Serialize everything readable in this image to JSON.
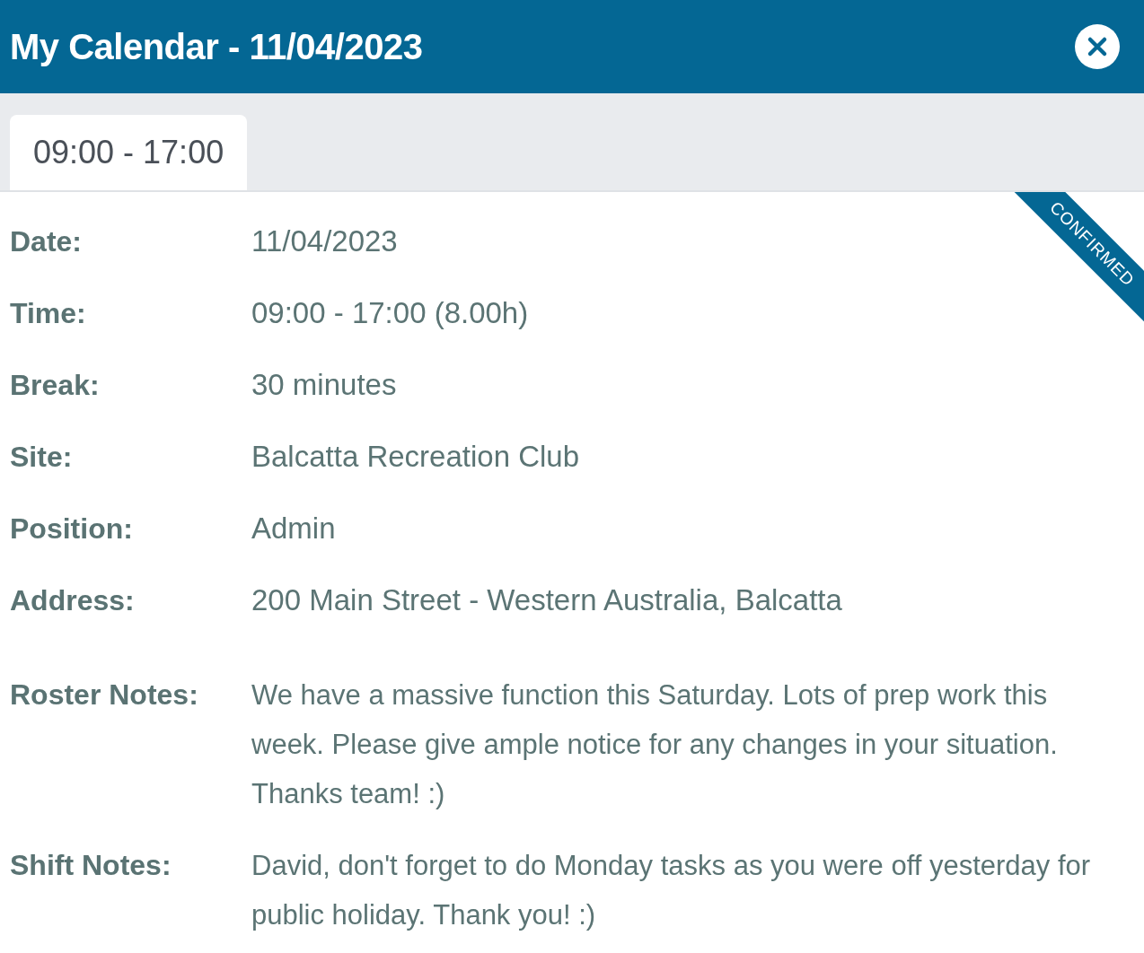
{
  "window": {
    "title": "My Calendar - 11/04/2023"
  },
  "tabs": [
    {
      "label": "09:00 - 17:00",
      "selected": true
    }
  ],
  "status": {
    "label": "CONFIRMED"
  },
  "details": [
    {
      "kind": "field",
      "label": "Date:",
      "value": "11/04/2023"
    },
    {
      "kind": "field",
      "label": "Time:",
      "value": "09:00 - 17:00 (8.00h)"
    },
    {
      "kind": "field",
      "label": "Break:",
      "value": "30 minutes"
    },
    {
      "kind": "field",
      "label": "Site:",
      "value": "Balcatta Recreation Club"
    },
    {
      "kind": "field",
      "label": "Position:",
      "value": "Admin"
    },
    {
      "kind": "field",
      "label": "Address:",
      "value": "200 Main Street - Western Australia, Balcatta"
    },
    {
      "kind": "note",
      "label": "Roster Notes:",
      "value": "We have a massive function this Saturday. Lots of prep work this week. Please give ample notice for any changes in your situation. Thanks team! :)"
    },
    {
      "kind": "note",
      "label": "Shift Notes:",
      "value": "David, don't forget to do Monday tasks as you were off yesterday for public holiday. Thank you! :)"
    }
  ]
}
